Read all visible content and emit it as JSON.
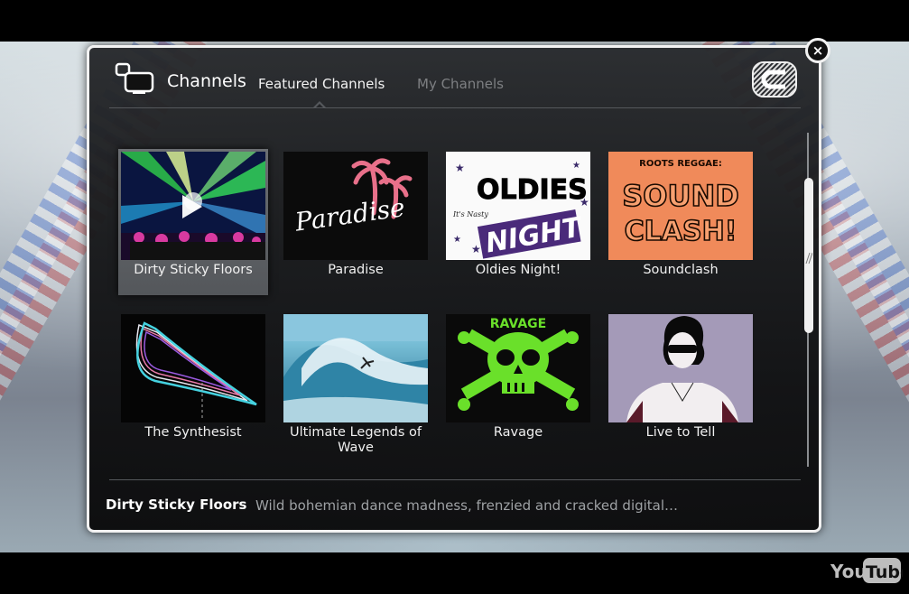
{
  "header": {
    "title": "Channels",
    "tabs": [
      {
        "label": "Featured Channels",
        "active": true
      },
      {
        "label": "My Channels",
        "active": false
      }
    ]
  },
  "close_label": "×",
  "channels": [
    {
      "name": "Dirty Sticky Floors",
      "selected": true
    },
    {
      "name": "Paradise",
      "thumb_text": "Paradise"
    },
    {
      "name": "Oldies Night!",
      "thumb_text_top": "OLDIES",
      "thumb_text_small": "It's Nasty",
      "thumb_text_bottom": "NIGHT"
    },
    {
      "name": "Soundclash",
      "thumb_text_small": "ROOTS REGGAE:",
      "thumb_text_1": "SOUND",
      "thumb_text_2": "CLASH!"
    },
    {
      "name": "The Synthesist"
    },
    {
      "name": "Ultimate Legends of Wave"
    },
    {
      "name": "Ravage",
      "thumb_text": "RAVAGE"
    },
    {
      "name": "Live to Tell"
    }
  ],
  "footer": {
    "selected_title": "Dirty Sticky Floors",
    "description": "Wild bohemian dance madness, frenzied and cracked digital…"
  },
  "brand": {
    "you": "You",
    "tube": "Tube"
  },
  "colors": {
    "panel_border": "#f2f2f2",
    "tab_active": "#f2f2f2",
    "tab_inactive": "#7d7f82"
  }
}
